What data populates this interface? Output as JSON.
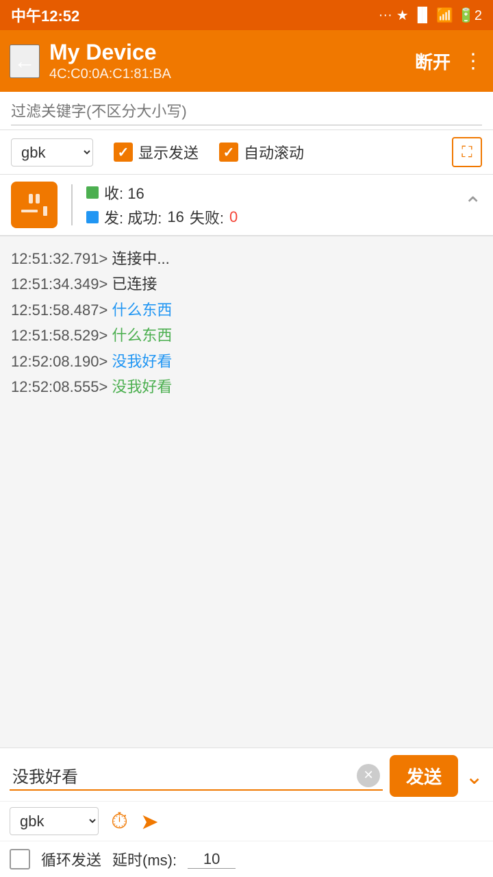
{
  "statusBar": {
    "time": "中午12:52",
    "battery": "2"
  },
  "topBar": {
    "deviceName": "My Device",
    "deviceMac": "4C:C0:0A:C1:81:BA",
    "disconnectLabel": "断开",
    "backIcon": "←",
    "moreIcon": "⋮"
  },
  "filter": {
    "placeholder": "过滤关键字(不区分大小写)"
  },
  "controls": {
    "encoding": "gbk",
    "showSendLabel": "显示发送",
    "autoScrollLabel": "自动滚动"
  },
  "stats": {
    "recvLabel": "收: 16",
    "sendLabel": "发: 成功: 16 失败: 0",
    "sendSuccessCount": "16",
    "sendFailCount": "0"
  },
  "logs": [
    {
      "time": "12:51:32.791>",
      "msg": "连接中...",
      "color": "black"
    },
    {
      "time": "12:51:34.349>",
      "msg": "已连接",
      "color": "black"
    },
    {
      "time": "12:51:58.487>",
      "msg": "什么东西",
      "color": "blue"
    },
    {
      "time": "12:51:58.529>",
      "msg": "什么东西",
      "color": "green"
    },
    {
      "time": "12:52:08.190>",
      "msg": "没我好看",
      "color": "blue"
    },
    {
      "time": "12:52:08.555>",
      "msg": "没我好看",
      "color": "green"
    }
  ],
  "sendArea": {
    "inputValue": "没我好看",
    "sendBtnLabel": "发送",
    "encoding2": "gbk",
    "loopLabel": "循环发送",
    "delayLabel": "延时(ms):",
    "delayValue": "10"
  }
}
